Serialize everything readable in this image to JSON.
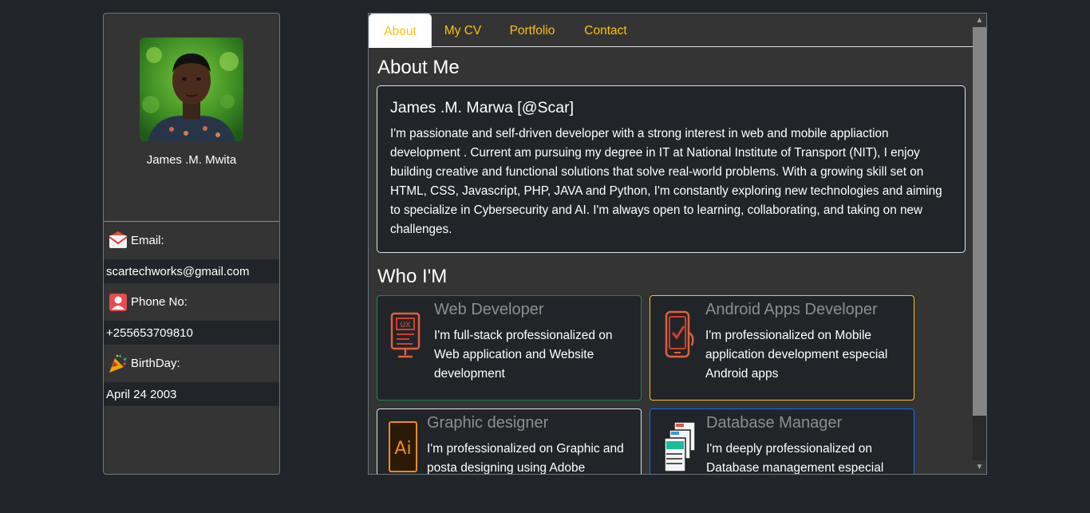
{
  "profile": {
    "name": "James .M. Mwita",
    "email_label": "Email:",
    "email": "scartechworks@gmail.com",
    "phone_label": "Phone No:",
    "phone": "+255653709810",
    "birthday_label": "BirthDay:",
    "birthday": "April 24 2003"
  },
  "tabs": [
    {
      "label": "About",
      "active": true
    },
    {
      "label": "My CV",
      "active": false
    },
    {
      "label": "Portfolio",
      "active": false
    },
    {
      "label": "Contact",
      "active": false
    }
  ],
  "about": {
    "section_title": "About Me",
    "card_title": "James .M. Marwa [@Scar]",
    "text": "I'm passionate and self-driven developer with a strong interest in web and mobile appliaction development . Current am pursuing my degree in IT at National Institute of Transport (NIT), I enjoy building creative and functional solutions that solve real-world problems. With a growing skill set on HTML, CSS, Javascript, PHP, JAVA and Python, I'm constantly exploring new technologies and aiming to specialize in Cybersecurity and AI. I'm always open to learning, collaborating, and taking on new challenges."
  },
  "who": {
    "section_title": "Who I'M",
    "skills": [
      {
        "title": "Web Developer",
        "text": "I'm full-stack professionalized on Web application and Website development",
        "border": "#198754",
        "icon": "ux-monitor-icon"
      },
      {
        "title": "Android Apps Developer",
        "text": "I'm professionalized on Mobile application development especial Android apps",
        "border": "#ffc107",
        "icon": "smartphone-check-icon"
      },
      {
        "title": "Graphic designer",
        "text": "I'm professionalized on Graphic and posta designing using Adobe",
        "border": "#dee2e6",
        "icon": "adobe-illustrator-icon"
      },
      {
        "title": "Database Manager",
        "text": "I'm deeply professionalized on Database management especial",
        "border": "#0d6efd",
        "icon": "database-stack-icon"
      }
    ]
  },
  "colors": {
    "background": "#212529",
    "panel": "#343434",
    "tab_text": "#ffc107",
    "success_border": "#198754",
    "warning_border": "#ffc107",
    "primary_border": "#0d6efd"
  }
}
